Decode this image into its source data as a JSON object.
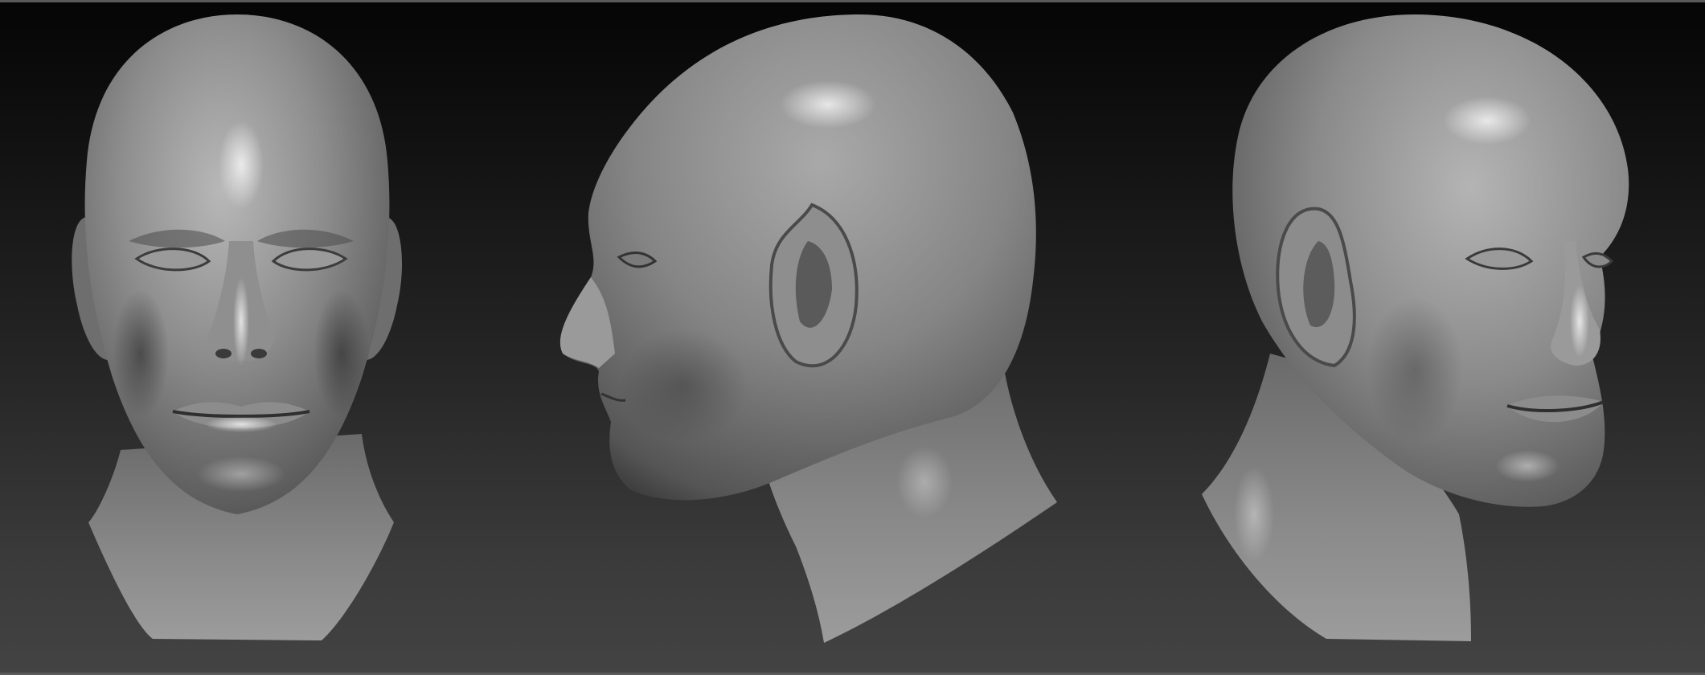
{
  "scene": {
    "background_top": "#050505",
    "background_bottom": "#434343",
    "sculpt_base": "#8a8a8a",
    "sculpt_shadow": "#3a3a3a",
    "sculpt_highlight": "#d9d9d9",
    "views": [
      {
        "name": "front-view"
      },
      {
        "name": "side-profile-view"
      },
      {
        "name": "three-quarter-view"
      }
    ]
  }
}
